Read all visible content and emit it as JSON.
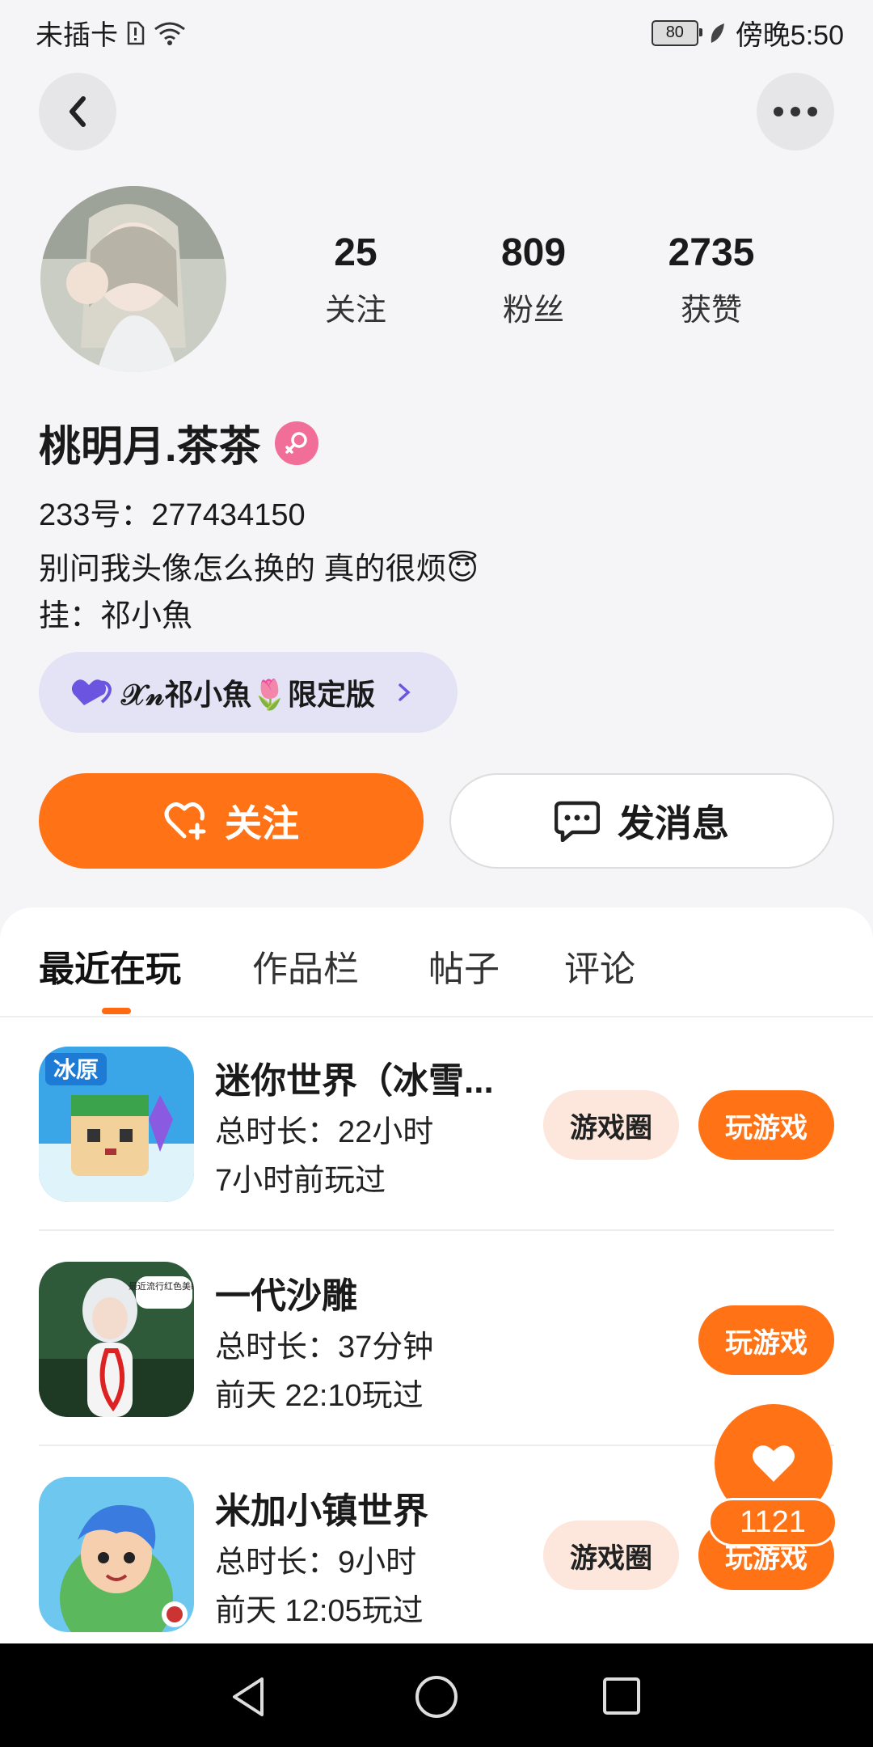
{
  "status_bar": {
    "carrier": "未插卡",
    "battery": "80",
    "time": "傍晚5:50"
  },
  "profile": {
    "stats": [
      {
        "value": "25",
        "label": "关注"
      },
      {
        "value": "809",
        "label": "粉丝"
      },
      {
        "value": "2735",
        "label": "获赞"
      }
    ],
    "username": "桃明月.茶茶",
    "id_label": "233号：277434150",
    "bio_line1": "别问我头像怎么换的 真的很烦😇",
    "bio_line2": "挂：祁小魚",
    "guild_tag": "𝒳𝓃祁小魚🌷限定版"
  },
  "actions": {
    "follow": "关注",
    "message": "发消息"
  },
  "tabs": [
    "最近在玩",
    "作品栏",
    "帖子",
    "评论"
  ],
  "games": [
    {
      "title": "迷你世界（冰雪...",
      "duration": "总时长：22小时",
      "last_played": "7小时前玩过",
      "circle_label": "游戏圈",
      "play_label": "玩游戏",
      "icon_text": "冰原"
    },
    {
      "title": "一代沙雕",
      "duration": "总时长：37分钟",
      "last_played": "前天 22:10玩过",
      "play_label": "玩游戏",
      "icon_text": "最近流行红色美瞳"
    },
    {
      "title": "米加小镇世界",
      "duration": "总时长：9小时",
      "last_played": "前天 12:05玩过",
      "circle_label": "游戏圈",
      "play_label": "玩游戏"
    }
  ],
  "floating_like_count": "1121",
  "colors": {
    "accent": "#ff7316",
    "pill_bg": "#fde6dc",
    "guild_bg": "#e4e2f5"
  }
}
